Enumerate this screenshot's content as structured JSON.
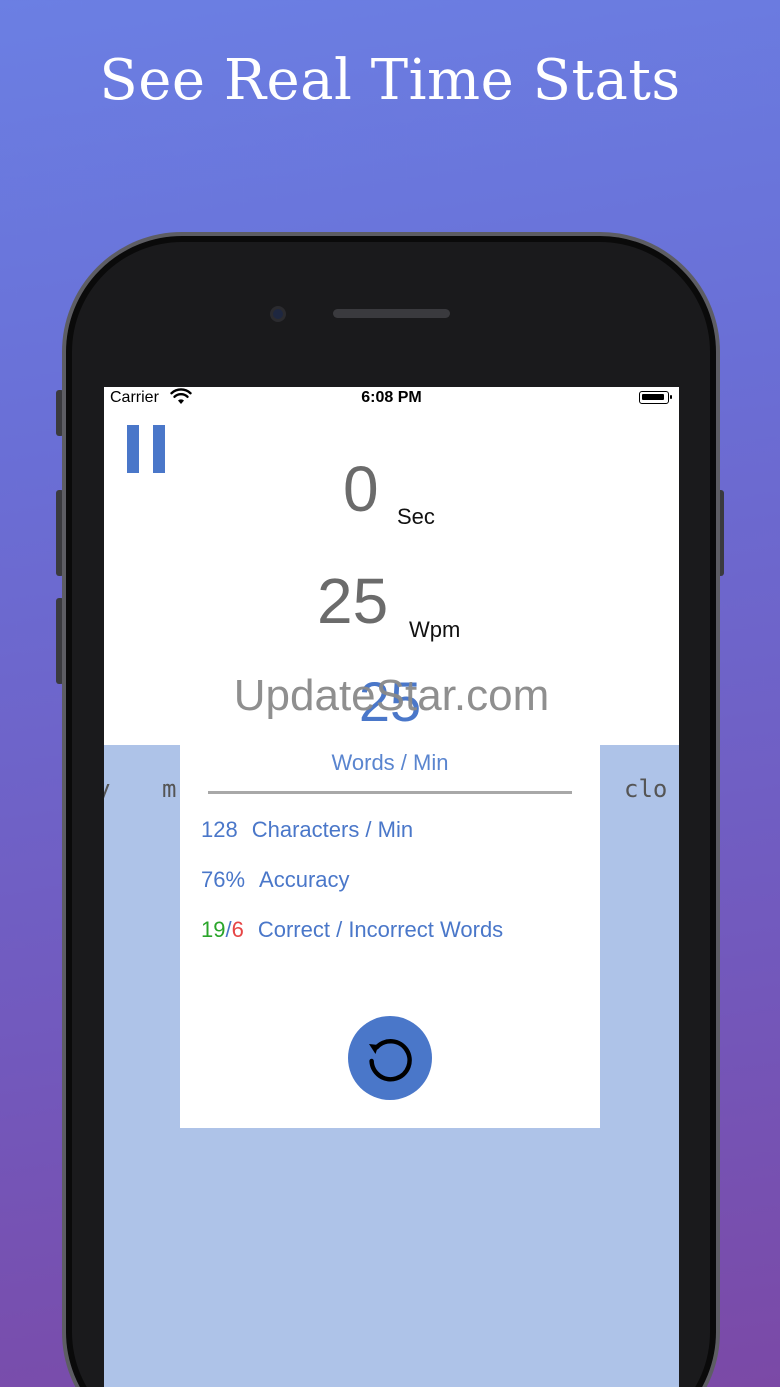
{
  "headline": "See Real Time Stats",
  "status_bar": {
    "carrier": "Carrier",
    "time": "6:08 PM",
    "wifi_icon": "wifi-icon",
    "battery_icon": "battery-icon"
  },
  "controls": {
    "pause_icon": "pause-icon"
  },
  "live": {
    "seconds": "0",
    "seconds_unit": "Sec",
    "wpm": "25",
    "wpm_unit": "Wpm"
  },
  "watermark": "UpdateStar.com",
  "typing_words": [
    "y",
    "m",
    "clo"
  ],
  "results": {
    "wpm": "25",
    "wpm_label": "Words / Min",
    "cpm": "128",
    "cpm_label": "Characters / Min",
    "accuracy": "76%",
    "accuracy_label": "Accuracy",
    "correct_words": "19",
    "slash": "/",
    "incorrect_words": "6",
    "words_label": "Correct / Incorrect Words",
    "restart_icon": "restart-icon"
  },
  "colors": {
    "accent": "#4a77c9",
    "correct": "#2aa52a",
    "incorrect": "#e64545",
    "text_area_bg": "#aec3e8"
  }
}
